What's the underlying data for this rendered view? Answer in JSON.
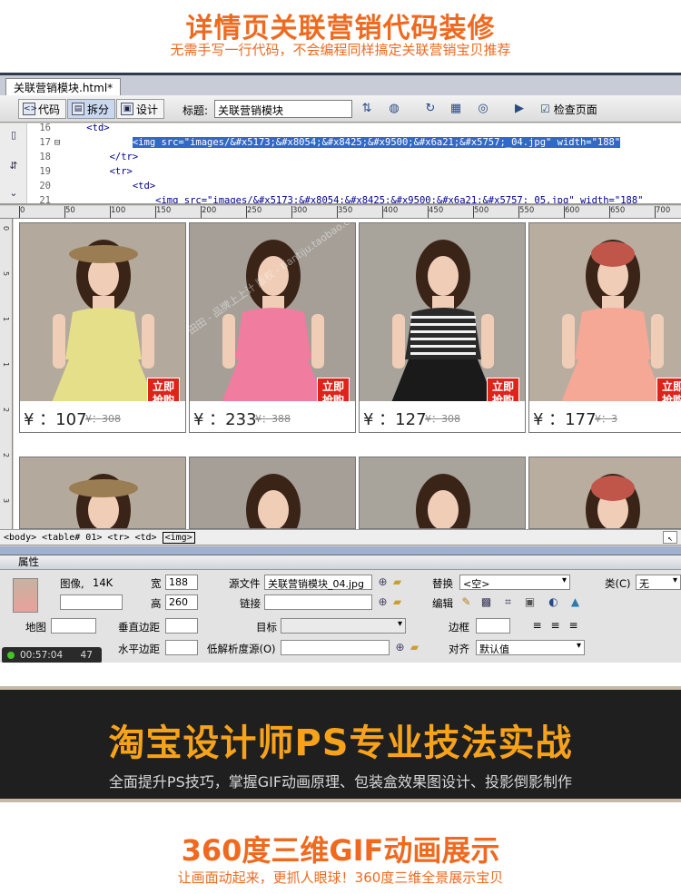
{
  "banner": {
    "title": "详情页关联营销代码装修",
    "subtitle": "无需手写一行代码，不会编程同样搞定关联营销宝贝推荐"
  },
  "editor": {
    "tab_label": "关联营销模块.html*",
    "toolbar": {
      "code_label": "代码",
      "split_label": "拆分",
      "design_label": "设计",
      "title_label": "标题:",
      "title_value": "关联营销模块",
      "check_page_label": "检查页面"
    },
    "code_lines": [
      {
        "num": "16",
        "fold": "",
        "text": "<td>",
        "indent": 1,
        "selected": false
      },
      {
        "num": "17",
        "fold": "⊟",
        "text": "<img src=\"images/&#x5173;&#x8054;&#x8425;&#x9500;&#x6a21;&#x5757;_04.jpg\" width=\"188\"",
        "indent": 3,
        "selected": true
      },
      {
        "num": "18",
        "fold": "",
        "text": "</tr>",
        "indent": 2,
        "selected": false
      },
      {
        "num": "19",
        "fold": "",
        "text": "<tr>",
        "indent": 2,
        "selected": false
      },
      {
        "num": "20",
        "fold": "",
        "text": "<td>",
        "indent": 3,
        "selected": false
      },
      {
        "num": "21",
        "fold": "",
        "text": "<img src=\"images/&#x5173;&#x8054;&#x8425;&#x9500;&#x6a21;&#x5757;_05.jpg\" width=\"188\"",
        "indent": 4,
        "selected": false
      }
    ],
    "ruler_top_ticks": [
      "0",
      "50",
      "100",
      "150",
      "200",
      "250",
      "300",
      "350",
      "400",
      "450",
      "500",
      "550",
      "600",
      "650",
      "700"
    ],
    "ruler_left_ticks": [
      "0",
      "5",
      "1",
      "1",
      "2",
      "2",
      "3"
    ],
    "products": [
      {
        "price": "¥ ：107",
        "old_price": "¥：308",
        "buy": "立即抢购",
        "dress": "#e6df8a",
        "hat": "#9a7d52",
        "bg": "#b3aa9d"
      },
      {
        "price": "¥ ：233",
        "old_price": "¥：388",
        "buy": "立即抢购",
        "dress": "#f07ca0",
        "hat": "",
        "bg": "#a59f97"
      },
      {
        "price": "¥ ：127",
        "old_price": "¥：308",
        "buy": "立即抢购",
        "dress": "#2a2a2a",
        "hat": "",
        "bg": "#a8a39b"
      },
      {
        "price": "¥ ：177",
        "old_price": "¥：3",
        "buy": "立即抢购",
        "dress": "#f5a896",
        "hat": "#c0554a",
        "bg": "#b9ad9f"
      }
    ],
    "watermark": "田田 - 品牌上上计 版权 - tiantiju.taobao.com",
    "tag_path": "<body> <table#  01> <tr> <td>",
    "tag_current": "<img>",
    "properties": {
      "panel_title": "属性",
      "type_label": "图像,",
      "size_label": "14K",
      "width_label": "宽",
      "width_value": "188",
      "height_label": "高",
      "height_value": "260",
      "src_label": "源文件",
      "src_value": "关联营销模块_04.jpg",
      "link_label": "链接",
      "link_value": "",
      "alt_label": "替换",
      "alt_value": "<空>",
      "class_label": "类(C)",
      "class_value": "无",
      "edit_label": "编辑",
      "map_label": "地图",
      "vspace_label": "垂直边距",
      "target_label": "目标",
      "border_label": "边框",
      "hspace_label": "水平边距",
      "lowsrc_label": "低解析度源(O)",
      "align_label": "对齐",
      "align_value": "默认值",
      "timer": "00:57:04",
      "timer_count": "47"
    }
  },
  "promo": {
    "title": "淘宝设计师PS专业技法实战",
    "subtitle": "全面提升PS技巧，掌握GIF动画原理、包装盒效果图设计、投影倒影制作"
  },
  "feature": {
    "title": "360度三维GIF动画展示",
    "subtitle": "让画面动起来，更抓人眼球！360度三维全景展示宝贝"
  }
}
